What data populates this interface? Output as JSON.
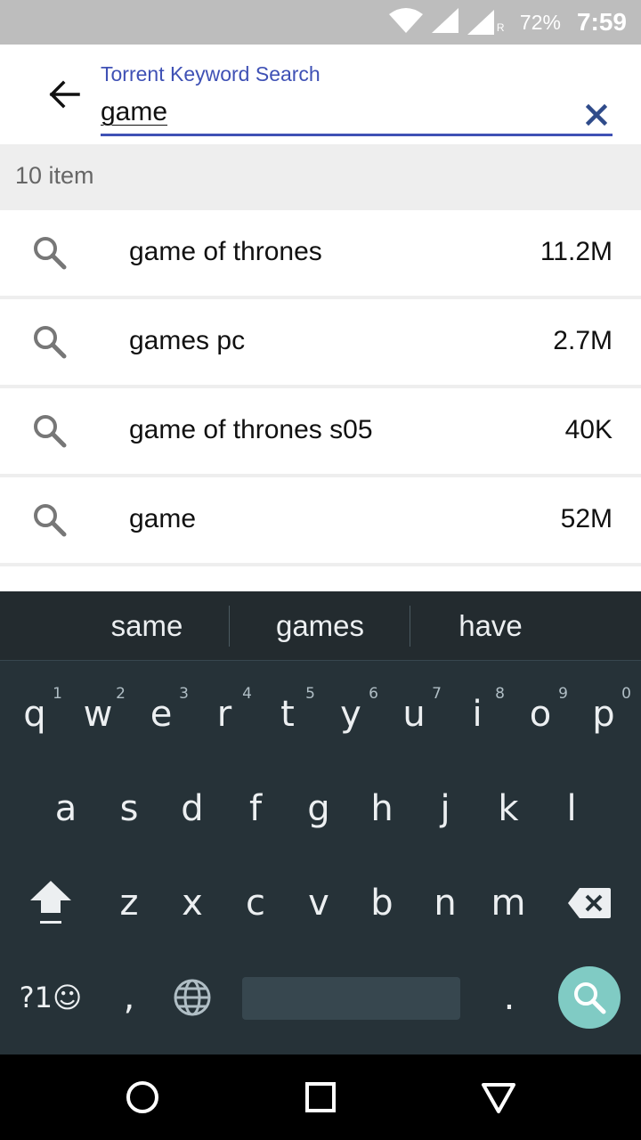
{
  "status_bar": {
    "battery": "72%",
    "time": "7:59",
    "roaming": "R"
  },
  "search": {
    "label": "Torrent Keyword Search",
    "value": "game"
  },
  "results": {
    "count_text": "10 item",
    "items": [
      {
        "label": "game of thrones",
        "count": "11.2M"
      },
      {
        "label": "games pc",
        "count": "2.7M"
      },
      {
        "label": "game of thrones s05",
        "count": "40K"
      },
      {
        "label": "game",
        "count": "52M"
      }
    ]
  },
  "keyboard": {
    "suggestions": [
      "same",
      "games",
      "have"
    ],
    "row1": [
      "q",
      "w",
      "e",
      "r",
      "t",
      "y",
      "u",
      "i",
      "o",
      "p"
    ],
    "row1_hints": [
      "1",
      "2",
      "3",
      "4",
      "5",
      "6",
      "7",
      "8",
      "9",
      "0"
    ],
    "row2": [
      "a",
      "s",
      "d",
      "f",
      "g",
      "h",
      "j",
      "k",
      "l"
    ],
    "row3": [
      "z",
      "x",
      "c",
      "v",
      "b",
      "n",
      "m"
    ],
    "symbols_key": "?1☺",
    "comma_key": ",",
    "period_key": ".",
    "action_color": "#80cbc4"
  },
  "colors": {
    "accent": "#3f51b5",
    "keyboard_bg": "#263238"
  }
}
